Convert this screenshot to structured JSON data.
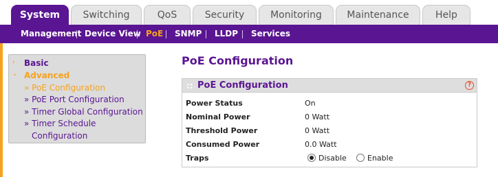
{
  "tabs": [
    {
      "label": "System",
      "active": true
    },
    {
      "label": "Switching",
      "active": false
    },
    {
      "label": "QoS",
      "active": false
    },
    {
      "label": "Security",
      "active": false
    },
    {
      "label": "Monitoring",
      "active": false
    },
    {
      "label": "Maintenance",
      "active": false
    },
    {
      "label": "Help",
      "active": false
    }
  ],
  "subnav": [
    {
      "label": "Management",
      "active": false
    },
    {
      "label": "Device View",
      "active": false
    },
    {
      "label": "PoE",
      "active": true
    },
    {
      "label": "SNMP",
      "active": false
    },
    {
      "label": "LLDP",
      "active": false
    },
    {
      "label": "Services",
      "active": false
    }
  ],
  "sidemenu": {
    "basic": "Basic",
    "advanced": "Advanced",
    "items": [
      "» PoE Configuration",
      "» PoE Port Configuration",
      "» Timer Global Configuration",
      "» Timer Schedule",
      "Configuration"
    ]
  },
  "page": {
    "title": "PoE Configuration",
    "panel_title": "PoE Configuration",
    "panel_grip": "::",
    "help_glyph": "?"
  },
  "rows": [
    {
      "label": "Power Status",
      "value": "On"
    },
    {
      "label": "Nominal Power",
      "value": "0 Watt"
    },
    {
      "label": "Threshold Power",
      "value": "0 Watt"
    },
    {
      "label": "Consumed Power",
      "value": "0.0 Watt"
    }
  ],
  "traps": {
    "label": "Traps",
    "options": [
      "Disable",
      "Enable"
    ],
    "selected": "Disable"
  },
  "colors": {
    "brand_purple": "#5a1592",
    "accent_orange": "#f7a21d",
    "help_red": "#e24b2c"
  },
  "icons": {
    "menu_arrow": "arrow-right-icon",
    "menu_arrow_open": "arrow-down-icon",
    "help": "help-icon"
  }
}
